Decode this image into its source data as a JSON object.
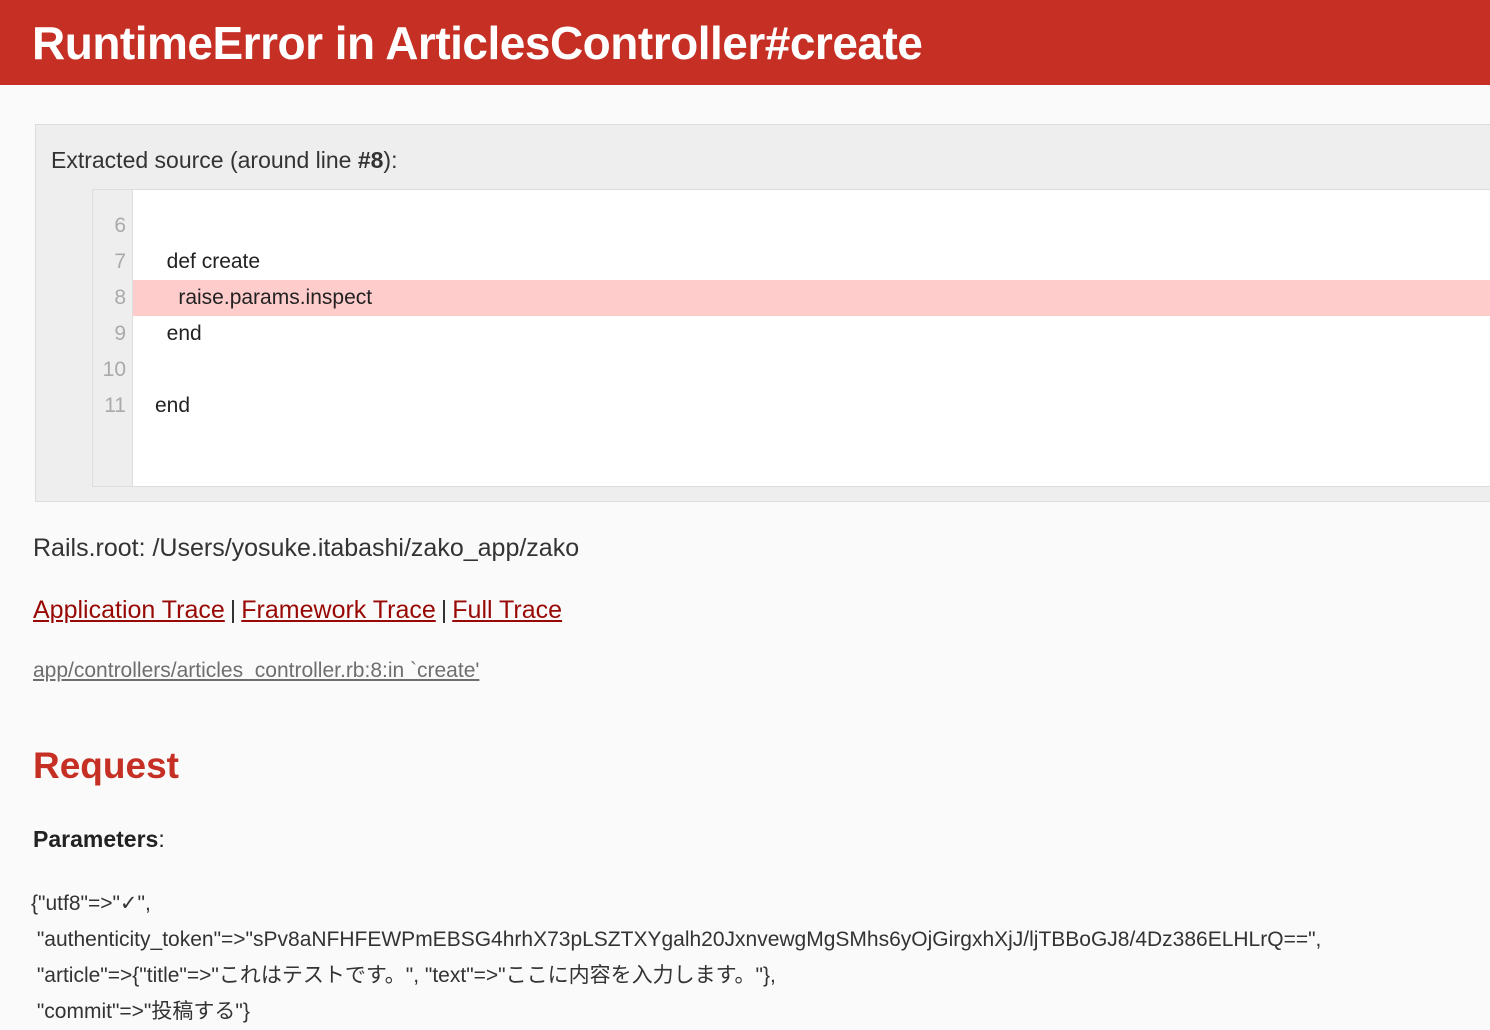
{
  "header": {
    "title": "RuntimeError in ArticlesController#create",
    "background_color": "#C52F24",
    "text_color": "#FFFFFF"
  },
  "source_panel": {
    "title_prefix": "Extracted source (around line ",
    "title_line": "#8",
    "title_suffix": "):",
    "highlighted_line": "8",
    "lines": [
      {
        "number": "6",
        "code": "",
        "highlighted": false
      },
      {
        "number": "7",
        "code": "  def create",
        "highlighted": false
      },
      {
        "number": "8",
        "code": "    raise.params.inspect",
        "highlighted": true
      },
      {
        "number": "9",
        "code": "  end",
        "highlighted": false
      },
      {
        "number": "10",
        "code": "",
        "highlighted": false
      },
      {
        "number": "11",
        "code": "end",
        "highlighted": false
      }
    ],
    "gutter_color": "#EEEEEE",
    "highlight_color": "#FFCCCC"
  },
  "rails_root": "Rails.root: /Users/yosuke.itabashi/zako_app/zako",
  "trace": {
    "links": [
      {
        "label": "Application Trace"
      },
      {
        "label": "Framework Trace"
      },
      {
        "label": "Full Trace"
      }
    ],
    "separator": "|",
    "link_color": "#980905",
    "entry": "app/controllers/articles_controller.rb:8:in `create'"
  },
  "request": {
    "heading": "Request",
    "parameters_label": "Parameters",
    "parameters_colon": ":",
    "parameters_value": "{\"utf8\"=>\"✓\",\n \"authenticity_token\"=>\"sPv8aNFHFEWPmEBSG4hrhX73pLSZTXYgalh20JxnvewgMgSMhs6yOjGirgxhXjJ/ljTBBoGJ8/4Dz386ELHLrQ==\",\n \"article\"=>{\"title\"=>\"これはテストです。\", \"text\"=>\"ここに内容を入力します。\"},\n \"commit\"=>\"投稿する\"}"
  }
}
